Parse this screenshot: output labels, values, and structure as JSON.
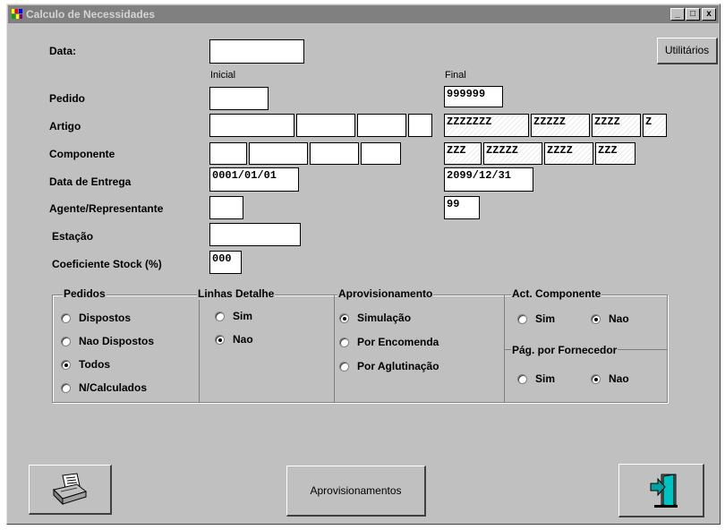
{
  "window": {
    "title": "Calculo de Necessidades",
    "controls": {
      "minimize": "_",
      "maximize": "□",
      "close": "x"
    }
  },
  "toolbar": {
    "utilitarios_label": "Utilitários"
  },
  "columns": {
    "inicial": "Inicial",
    "final": "Final"
  },
  "form": {
    "data_label": "Data:",
    "data_value": "",
    "pedido_label": "Pedido",
    "pedido_inicial": "",
    "pedido_final": "999999",
    "artigo_label": "Artigo",
    "artigo_final": [
      "ZZZZZZZ",
      "ZZZZZ",
      "ZZZZ",
      "Z"
    ],
    "componente_label": "Componente",
    "componente_final": [
      "ZZZ",
      "ZZZZZ",
      "ZZZZ",
      "ZZZ"
    ],
    "entrega_label": "Data de Entrega",
    "entrega_inicial": "0001/01/01",
    "entrega_final": "2099/12/31",
    "agente_label": "Agente/Representante",
    "agente_inicial": "",
    "agente_final": "99",
    "estacao_label": "Estação",
    "estacao_value": "",
    "coef_label": "Coeficiente Stock (%)",
    "coef_value": "000"
  },
  "groups": {
    "pedidos": {
      "title": "Pedidos",
      "options": [
        "Dispostos",
        "Nao Dispostos",
        "Todos",
        "N/Calculados"
      ],
      "selected": "Todos"
    },
    "linhas": {
      "title": "Linhas Detalhe",
      "options": [
        "Sim",
        "Nao"
      ],
      "selected": "Nao"
    },
    "aprov": {
      "title": "Aprovisionamento",
      "options": [
        "Simulação",
        "Por Encomenda",
        "Por Aglutinação"
      ],
      "selected": "Simulação"
    },
    "act": {
      "title": "Act. Componente",
      "options": [
        "Sim",
        "Nao"
      ],
      "selected": "Nao"
    },
    "pag": {
      "title": "Pág. por Fornecedor",
      "options": [
        "Sim",
        "Nao"
      ],
      "selected": "Nao"
    }
  },
  "buttons": {
    "aprovisionamentos_label": "Aprovisionamentos",
    "print_icon": "printer-icon",
    "exit_icon": "exit-door-icon"
  }
}
